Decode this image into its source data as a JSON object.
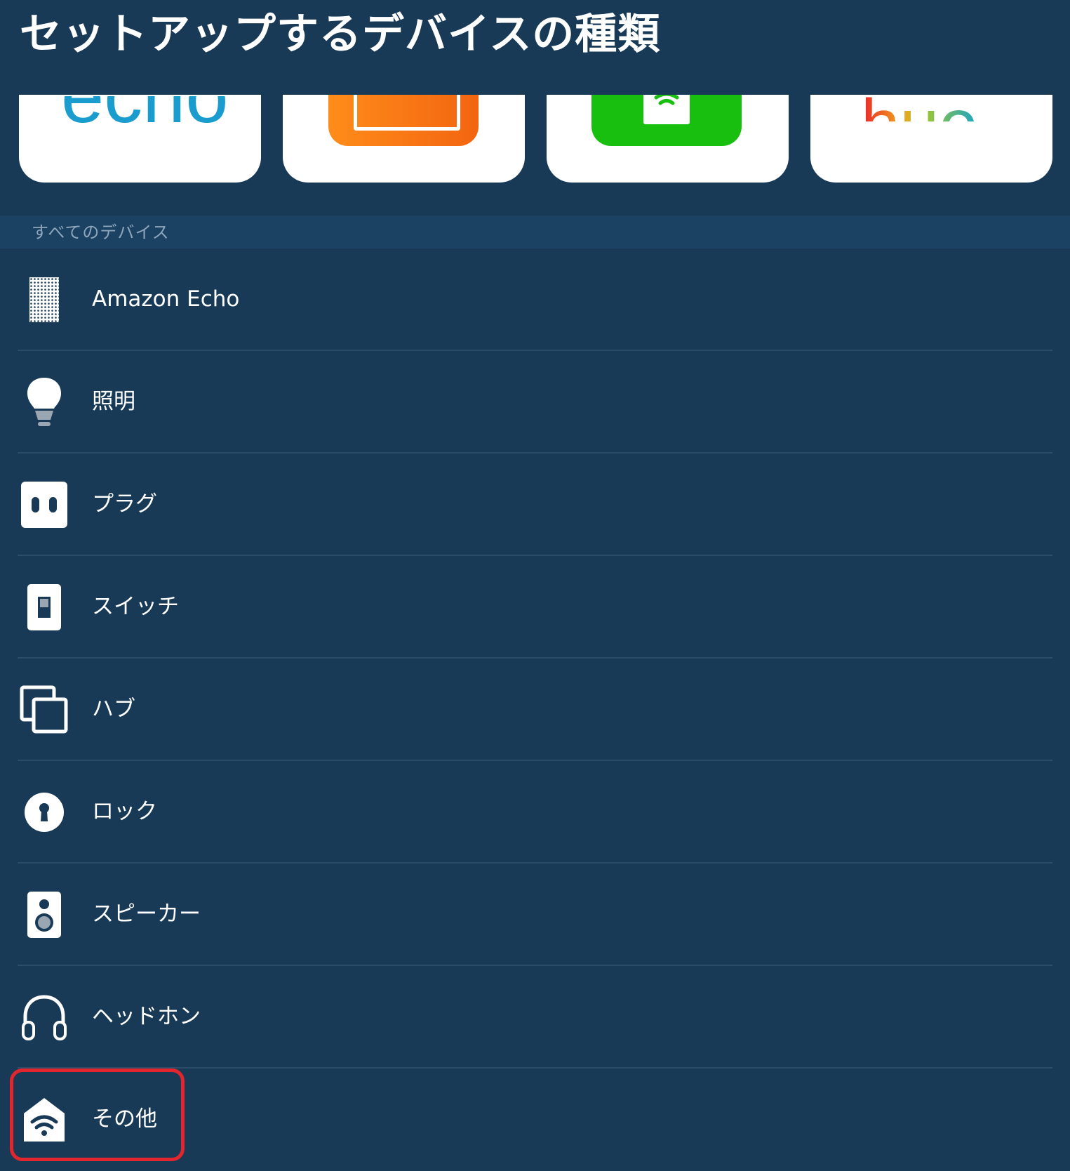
{
  "header": {
    "title": "セットアップするデバイスの種類"
  },
  "brands": [
    {
      "name": "echo",
      "logo_text": "echo",
      "color": "#1a9ccf"
    },
    {
      "name": "fire-tv",
      "color": "#f57a14"
    },
    {
      "name": "green-wifi",
      "color": "#19bf0e"
    },
    {
      "name": "hue",
      "logo_text": "hue"
    }
  ],
  "section": {
    "label": "すべてのデバイス"
  },
  "devices": [
    {
      "label": "Amazon Echo",
      "icon": "echo-speaker-icon"
    },
    {
      "label": "照明",
      "icon": "light-bulb-icon"
    },
    {
      "label": "プラグ",
      "icon": "plug-icon"
    },
    {
      "label": "スイッチ",
      "icon": "switch-icon"
    },
    {
      "label": "ハブ",
      "icon": "hub-icon"
    },
    {
      "label": "ロック",
      "icon": "lock-icon"
    },
    {
      "label": "スピーカー",
      "icon": "speaker-icon"
    },
    {
      "label": "ヘッドホン",
      "icon": "headphones-icon"
    },
    {
      "label": "その他",
      "icon": "other-home-wifi-icon",
      "highlighted": true
    }
  ],
  "colors": {
    "background": "#193a56",
    "section_header": "#1c4263",
    "divider": "#2c4d69",
    "highlight": "#e3262e"
  }
}
